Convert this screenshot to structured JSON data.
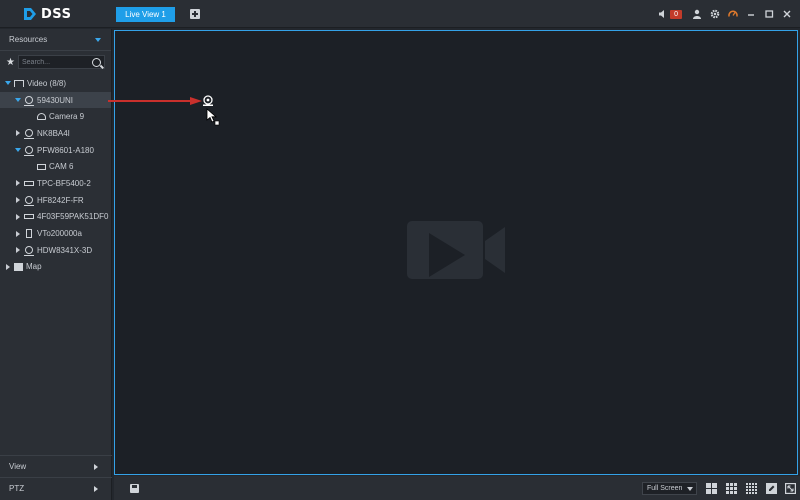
{
  "app": {
    "logo_text": "DSS"
  },
  "tabs": [
    {
      "label": "Live View 1",
      "active": true
    }
  ],
  "header": {
    "alarm_count": "0"
  },
  "sidebar": {
    "resources_label": "Resources",
    "search": {
      "placeholder": "Search..."
    },
    "tree": [
      {
        "label": "Video (8/8)",
        "icon": "video-group-icon",
        "level": 0,
        "expanded": true
      },
      {
        "label": "59430UNI",
        "icon": "camera-icon",
        "level": 1,
        "expanded": true,
        "selected": true
      },
      {
        "label": "Camera 9",
        "icon": "dome-camera-icon",
        "level": 2
      },
      {
        "label": "NK8BA4I",
        "icon": "camera-icon",
        "level": 1,
        "expanded": false
      },
      {
        "label": "PFW8601-A180",
        "icon": "camera-icon",
        "level": 1,
        "expanded": true
      },
      {
        "label": "CAM 6",
        "icon": "bullet-camera-icon",
        "level": 2
      },
      {
        "label": "TPC-BF5400-2",
        "icon": "nvr-icon",
        "level": 1,
        "expanded": false
      },
      {
        "label": "HF8242F-FR",
        "icon": "camera-icon",
        "level": 1,
        "expanded": false
      },
      {
        "label": "4F03F59PAK51DF0",
        "icon": "nvr-icon",
        "level": 1,
        "expanded": false
      },
      {
        "label": "VTo200000a",
        "icon": "door-station-icon",
        "level": 1,
        "expanded": false
      },
      {
        "label": "HDW8341X-3D",
        "icon": "camera-icon",
        "level": 1,
        "expanded": false
      },
      {
        "label": "Map",
        "icon": "map-icon",
        "level": 0,
        "expanded": false
      }
    ],
    "bottom_items": [
      {
        "label": "View"
      },
      {
        "label": "PTZ"
      }
    ]
  },
  "bottombar": {
    "window_mode": "Full Screen"
  },
  "colors": {
    "accent": "#1f9ee8",
    "alert": "#c23b2a",
    "arrow": "#c9302c"
  }
}
